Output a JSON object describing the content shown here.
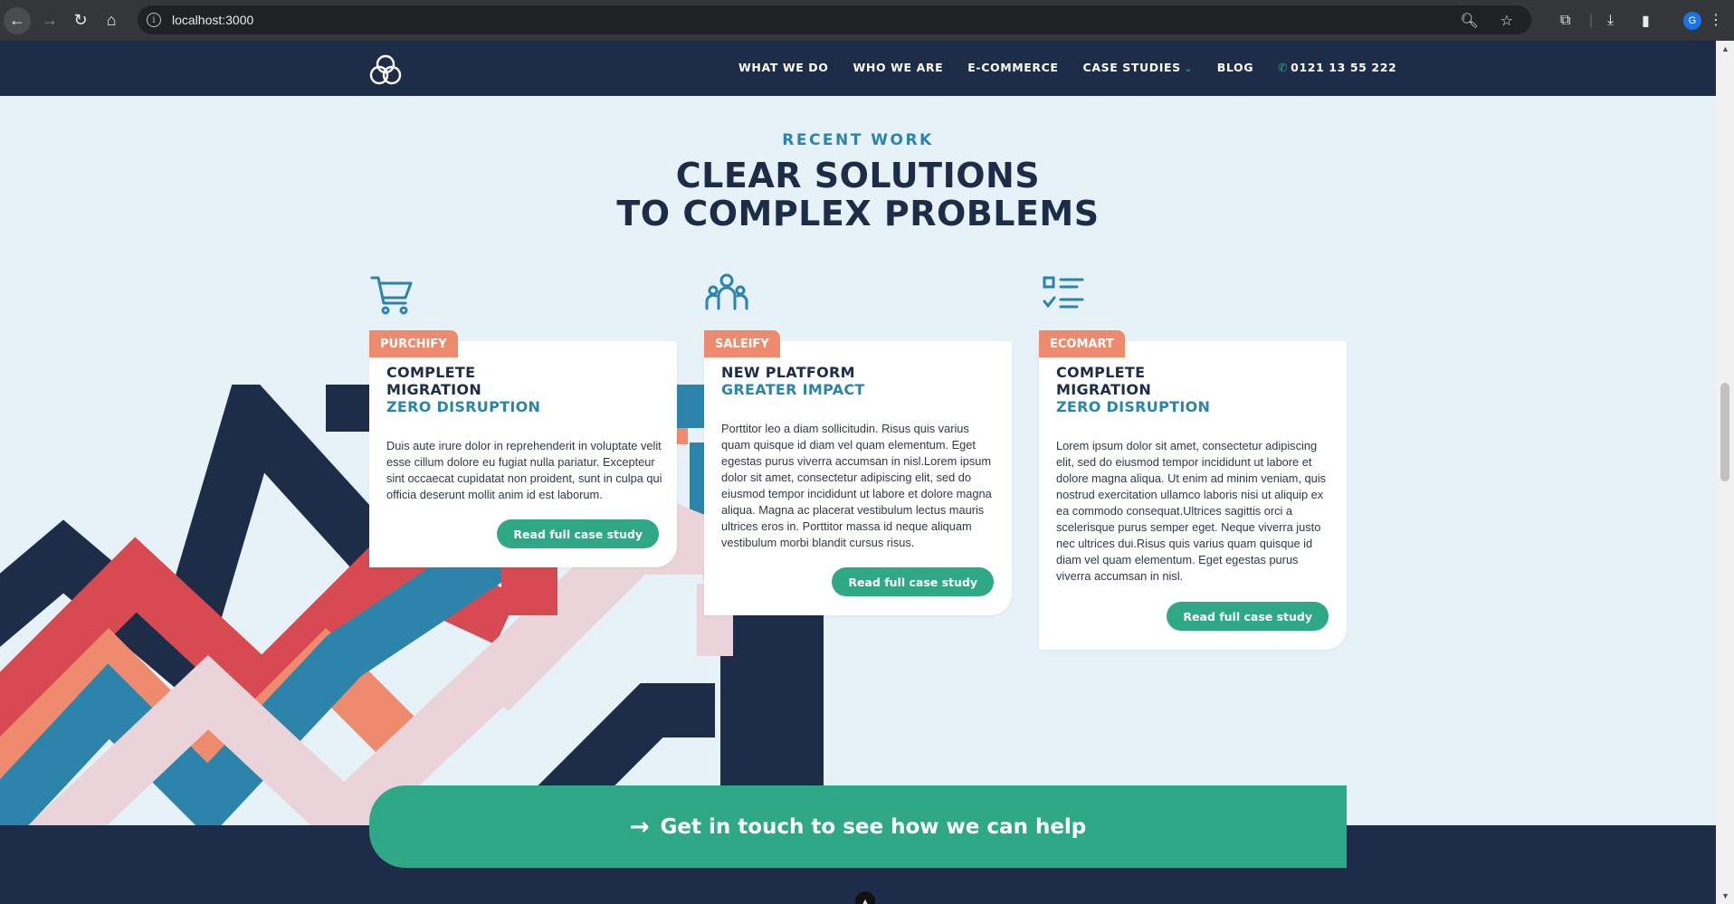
{
  "browser": {
    "url": "localhost:3000",
    "profile_initial": "G",
    "icons": [
      "back-icon",
      "forward-icon",
      "reload-icon",
      "home-icon",
      "site-info-icon",
      "zoom-icon",
      "bookmark-star-icon",
      "extensions-icon",
      "downloads-icon",
      "side-panel-icon",
      "menu-icon"
    ]
  },
  "nav": {
    "items": [
      "WHAT WE DO",
      "WHO WE ARE",
      "E-COMMERCE",
      "CASE STUDIES",
      "BLOG"
    ],
    "phone": "0121 13 55 222"
  },
  "section": {
    "eyebrow": "RECENT WORK",
    "headline_line1": "CLEAR SOLUTIONS",
    "headline_line2": "TO COMPLEX PROBLEMS"
  },
  "cards": [
    {
      "icon": "shopping-cart-icon",
      "tag": "PURCHIFY",
      "title_line1": "COMPLETE",
      "title_line2": "MIGRATION",
      "accent": "ZERO DISRUPTION",
      "body": "Duis aute irure dolor in reprehenderit in voluptate velit esse cillum dolore eu fugiat nulla pariatur. Excepteur sint occaecat cupidatat non proident, sunt in culpa qui officia deserunt mollit anim id est laborum.",
      "button": "Read full case study"
    },
    {
      "icon": "people-group-icon",
      "tag": "SALEIFY",
      "title_line1": "NEW PLATFORM",
      "title_line2": "",
      "accent": "GREATER IMPACT",
      "body": "Porttitor leo a diam sollicitudin. Risus quis varius quam quisque id diam vel quam elementum. Eget egestas purus viverra accumsan in nisl.Lorem ipsum dolor sit amet, consectetur adipiscing elit, sed do eiusmod tempor incididunt ut labore et dolore magna aliqua. Magna ac placerat vestibulum lectus mauris ultrices eros in. Porttitor massa id neque aliquam vestibulum morbi blandit cursus risus.",
      "button": "Read full case study"
    },
    {
      "icon": "checklist-icon",
      "tag": "ECOMART",
      "title_line1": "COMPLETE",
      "title_line2": "MIGRATION",
      "accent": "ZERO DISRUPTION",
      "body": "Lorem ipsum dolor sit amet, consectetur adipiscing elit, sed do eiusmod tempor incididunt ut labore et dolore magna aliqua. Ut enim ad minim veniam, quis nostrud exercitation ullamco laboris nisi ut aliquip ex ea commodo consequat.Ultrices sagittis orci a scelerisque purus semper eget. Neque viverra justo nec ultrices dui.Risus quis varius quam quisque id diam vel quam elementum. Eget egestas purus viverra accumsan in nisl.",
      "button": "Read full case study"
    }
  ],
  "cta": {
    "label": "Get in touch to see how we can help"
  },
  "colors": {
    "navy": "#1d2d48",
    "teal": "#2c84aa",
    "green": "#2ea886",
    "coral": "#ee8a6e",
    "red": "#d84a52",
    "pink": "#ead4da",
    "background": "#e6f1f8"
  }
}
